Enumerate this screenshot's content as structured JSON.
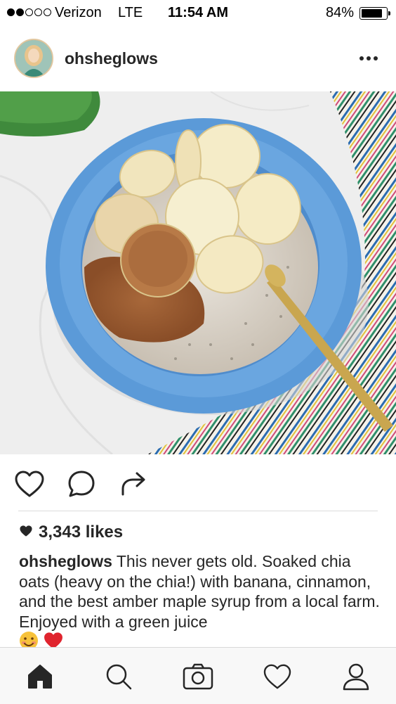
{
  "status_bar": {
    "carrier": "Verizon",
    "network": "LTE",
    "time": "11:54 AM",
    "battery_percent": "84%",
    "battery_level": 0.84,
    "signal_bars_filled": 2,
    "signal_bars_total": 5
  },
  "post": {
    "username": "ohsheglows",
    "avatar_icon": "profile-avatar",
    "more_icon": "more-horizontal-icon",
    "image_description_icon": "chia-oats-bowl-photo",
    "actions": {
      "like_icon": "heart-outline-icon",
      "comment_icon": "comment-bubble-icon",
      "share_icon": "share-arrow-icon"
    },
    "likes": "3,343 likes",
    "caption": {
      "user": "ohsheglows",
      "text": " This never gets old. Soaked chia oats (heavy on the chia!) with banana, cinnamon, and the best amber maple syrup from a local farm. Enjoyed with a green juice",
      "emojis": [
        "😊",
        "❤️"
      ]
    }
  },
  "tab_bar": {
    "items": [
      {
        "name": "home",
        "icon": "home-icon",
        "active": true
      },
      {
        "name": "search",
        "icon": "search-icon",
        "active": false
      },
      {
        "name": "camera",
        "icon": "camera-icon",
        "active": false
      },
      {
        "name": "activity",
        "icon": "heart-icon",
        "active": false
      },
      {
        "name": "profile",
        "icon": "person-icon",
        "active": false
      }
    ]
  },
  "colors": {
    "text": "#262626",
    "bowl_blue": "#5b9ad8",
    "tab_bar_bg": "#f8f8f8",
    "like_heart": "#262626"
  }
}
